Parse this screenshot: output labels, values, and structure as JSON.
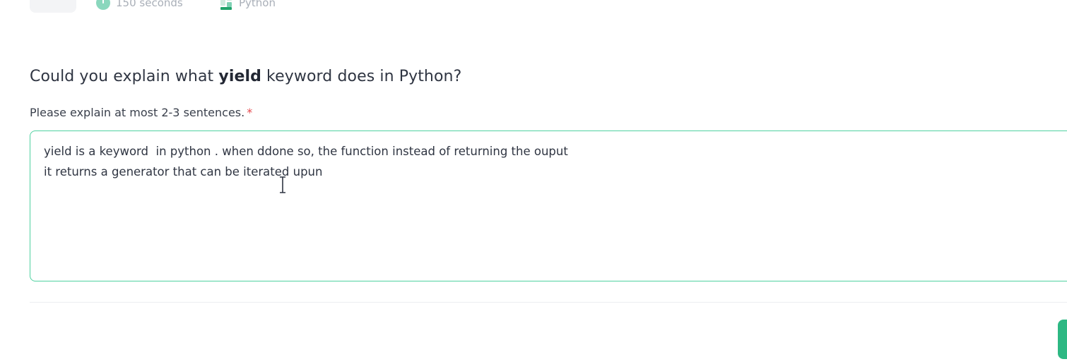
{
  "meta": {
    "time_limit": "150 seconds",
    "language": "Python"
  },
  "question": {
    "prefix": "Could you explain what ",
    "keyword": "yield",
    "suffix": " keyword does in Python?"
  },
  "answer": {
    "hint": "Please explain at most 2-3 sentences.",
    "required_mark": "*",
    "line1": "yield is a keyword  in python . when ddone so, the function instead of returning the ouput",
    "line2": "it returns a generator that can be iterated upun"
  },
  "colors": {
    "accent": "#4fd1a0",
    "button": "#2db883",
    "required": "#e5484d"
  },
  "icons": [
    "clock-icon",
    "code-language-icon",
    "text-cursor-icon"
  ]
}
